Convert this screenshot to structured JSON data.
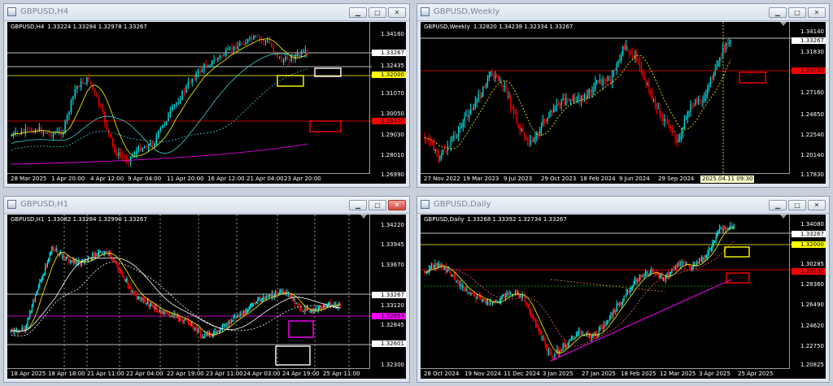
{
  "windows": [
    {
      "title": "GBPUSD,H4",
      "symbol": "GBPUSD,H4",
      "ohlc": "1.33224 1.33284 1.32978 1.33267",
      "prices": [
        "1.34160",
        "1.33267",
        "1.32435",
        "1.32000",
        "1.31070",
        "1.30050",
        "1.29700",
        "1.29030",
        "1.28010",
        "1.26990"
      ],
      "dates": [
        "28 Mar 2025",
        "1 Apr 20:00",
        "4 Apr 12:00",
        "9 Apr 04:00",
        "11 Apr 20:00",
        "16 Apr 12:00",
        "21 Apr 04:00",
        "23 Apr 20:00"
      ]
    },
    {
      "title": "GBPUSD,Weekly",
      "symbol": "GBPUSD,Weekly",
      "ohlc": "1.32820 1.34238 1.32334 1.33267",
      "prices": [
        "1.34140",
        "1.33267",
        "1.31830",
        "1.29700",
        "1.27160",
        "1.24850",
        "1.22540",
        "1.20140",
        "1.17830"
      ],
      "dates": [
        "27 Nov 2022",
        "19 Mar 2023",
        "9 Jul 2023",
        "29 Oct 2023",
        "18 Feb 2024",
        "9 Jun 2024",
        "29 Sep 2024"
      ],
      "cursor_time": "2025.04.11 09:30"
    },
    {
      "title": "GBPUSD,H1",
      "symbol": "GBPUSD,H1",
      "ohlc": "1.33082 1.33284 1.32990 1.33267",
      "prices": [
        "1.34220",
        "1.33945",
        "1.33670",
        "1.33267",
        "1.33120",
        "1.32857",
        "1.32845",
        "1.32601",
        "1.32300"
      ],
      "dates": [
        "18 Apr 2025",
        "18 Apr 18:00",
        "21 Apr 11:00",
        "22 Apr 04:00",
        "22 Apr 19:00",
        "23 Apr 11:00",
        "24 Apr 03:00",
        "24 Apr 19:00",
        "25 Apr 11:00"
      ]
    },
    {
      "title": "GBPUSD,Daily",
      "symbol": "GBPUSD,Daily",
      "ohlc": "1.33268 1.33392 1.32734 1.33267",
      "prices": [
        "1.34080",
        "1.33267",
        "1.32000",
        "1.30285",
        "1.29700",
        "1.28360",
        "1.26490",
        "1.24620",
        "1.22750",
        "1.20825"
      ],
      "dates": [
        "28 Oct 2024",
        "19 Nov 2024",
        "11 Dec 2024",
        "3 Jan 2025",
        "27 Jan 2025",
        "18 Feb 2025",
        "12 Mar 2025",
        "3 Apr 2025",
        "25 Apr 2025"
      ]
    }
  ],
  "buttons": {
    "min": "▁",
    "max": "□",
    "close": "✕"
  },
  "colors": {
    "bg": "#000000",
    "bull": "#00e5e5",
    "bear": "#ff0000",
    "yellow": "#ffff00",
    "magenta": "#ff00ff",
    "white": "#ffffff"
  }
}
